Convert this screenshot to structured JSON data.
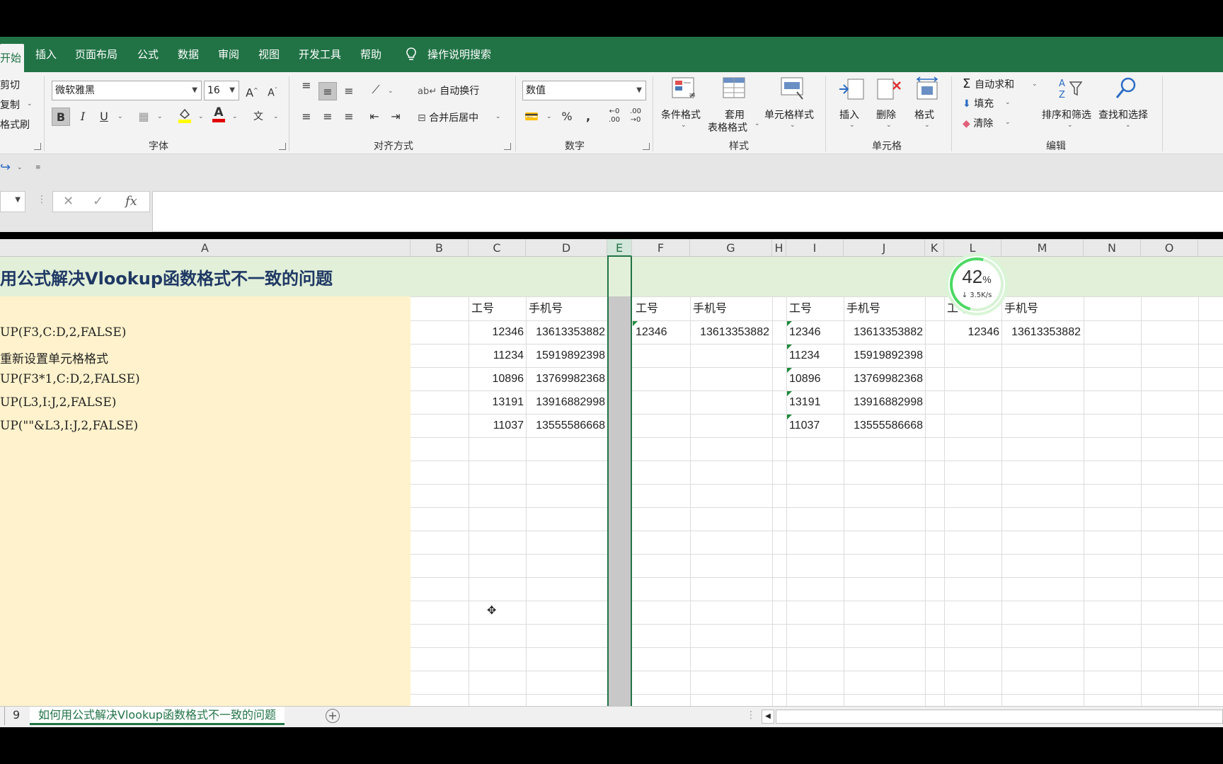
{
  "ribbon_tabs": [
    "开始",
    "插入",
    "页面布局",
    "公式",
    "数据",
    "审阅",
    "视图",
    "开发工具",
    "帮助"
  ],
  "tell_me": "操作说明搜索",
  "clipboard": {
    "cut": "剪切",
    "copy": "复制",
    "format_painter": "格式刷"
  },
  "font": {
    "name": "微软雅黑",
    "size": "16",
    "group_label": "字体"
  },
  "alignment": {
    "wrap": "自动换行",
    "merge": "合并后居中",
    "group_label": "对齐方式"
  },
  "number": {
    "format": "数值",
    "group_label": "数字"
  },
  "styles": {
    "conditional": "条件格式",
    "table_line1": "套用",
    "table_line2": "表格格式",
    "cell_styles": "单元格样式",
    "group_label": "样式"
  },
  "cells": {
    "insert": "插入",
    "delete": "删除",
    "format": "格式",
    "group_label": "单元格"
  },
  "editing": {
    "autosum": "自动求和",
    "fill": "填充",
    "clear": "清除",
    "sort": "排序和筛选",
    "find": "查找和选择",
    "group_label": "编辑"
  },
  "columns": [
    "A",
    "B",
    "C",
    "D",
    "E",
    "F",
    "G",
    "H",
    "I",
    "J",
    "K",
    "L",
    "M",
    "N",
    "O"
  ],
  "title": "用公式解决Vlookup函数格式不一致的问题",
  "formulas": [
    "UP(F3,C:D,2,FALSE)",
    "重新设置单元格格式",
    "UP(F3*1,C:D,2,FALSE)",
    "UP(L3,I:J,2,FALSE)",
    "UP(\"\"&L3,I:J,2,FALSE)"
  ],
  "headers": {
    "id": "工号",
    "phone": "手机号"
  },
  "table_cd": [
    [
      "12346",
      "13613353882"
    ],
    [
      "11234",
      "15919892398"
    ],
    [
      "10896",
      "13769982368"
    ],
    [
      "13191",
      "13916882998"
    ],
    [
      "11037",
      "13555586668"
    ]
  ],
  "table_fg": [
    [
      "12346",
      "13613353882"
    ]
  ],
  "table_ij": [
    [
      "12346",
      "13613353882"
    ],
    [
      "11234",
      "15919892398"
    ],
    [
      "10896",
      "13769982368"
    ],
    [
      "13191",
      "13916882998"
    ],
    [
      "11037",
      "13555586668"
    ]
  ],
  "table_lm": [
    [
      "12346",
      "13613353882"
    ]
  ],
  "speed_widget": {
    "percent": "42",
    "percent_unit": "%",
    "rate": "↓ 3.5K/s"
  },
  "sheet_tabs": {
    "prev": "9",
    "active": "如何用公式解决Vlookup函数格式不一致的问题"
  },
  "colors": {
    "excel_green": "#217346",
    "title_fill": "#e2f0d9",
    "colA_fill": "#fff2cc",
    "title_text": "#1f3864"
  }
}
